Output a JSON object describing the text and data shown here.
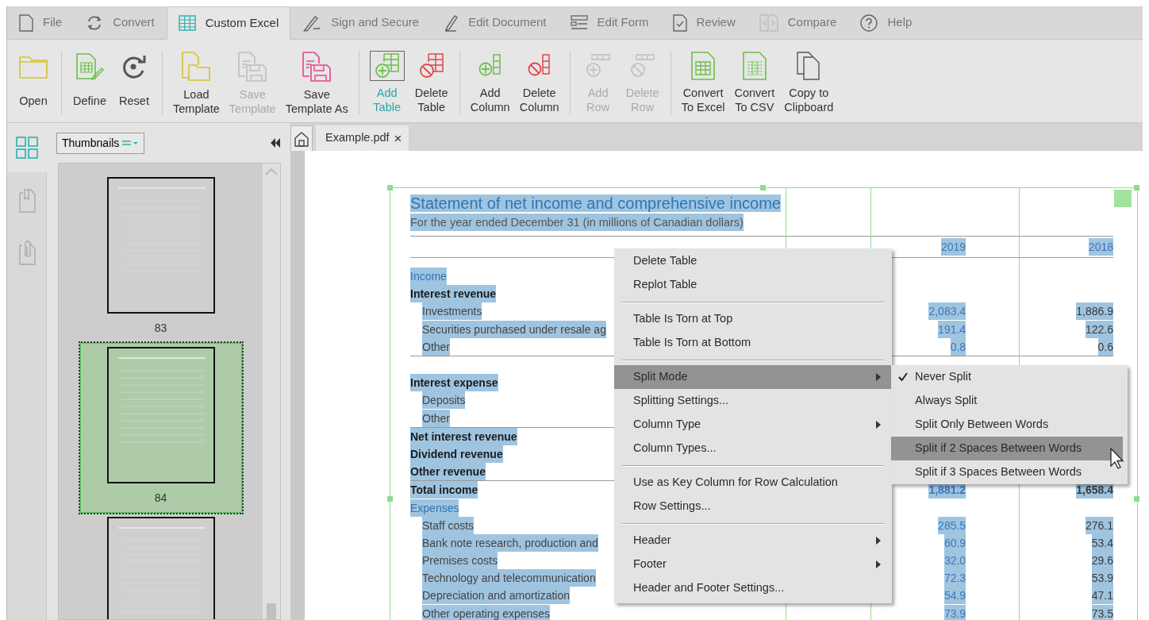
{
  "tabs": [
    {
      "label": "File",
      "selected": false
    },
    {
      "label": "Convert",
      "selected": false
    },
    {
      "label": "Custom Excel",
      "selected": true
    },
    {
      "label": "Sign and Secure",
      "selected": false
    },
    {
      "label": "Edit Document",
      "selected": false
    },
    {
      "label": "Edit Form",
      "selected": false
    },
    {
      "label": "Review",
      "selected": false
    },
    {
      "label": "Compare",
      "selected": false
    },
    {
      "label": "Help",
      "selected": false
    }
  ],
  "ribbon": {
    "groups": [
      [
        {
          "label": "Open",
          "disabled": false,
          "selected": false
        }
      ],
      [
        {
          "label": "Define",
          "disabled": false,
          "selected": false
        },
        {
          "label": "Reset",
          "disabled": false,
          "selected": false
        }
      ],
      [
        {
          "label": "Load\nTemplate",
          "disabled": false,
          "selected": false
        },
        {
          "label": "Save\nTemplate",
          "disabled": true,
          "selected": false
        },
        {
          "label": "Save\nTemplate As",
          "disabled": false,
          "selected": false
        }
      ],
      [
        {
          "label": "Add\nTable",
          "disabled": false,
          "selected": true
        },
        {
          "label": "Delete\nTable",
          "disabled": false,
          "selected": false
        }
      ],
      [
        {
          "label": "Add\nColumn",
          "disabled": false,
          "selected": false
        },
        {
          "label": "Delete\nColumn",
          "disabled": false,
          "selected": false
        }
      ],
      [
        {
          "label": "Add\nRow",
          "disabled": true,
          "selected": false
        },
        {
          "label": "Delete\nRow",
          "disabled": true,
          "selected": false
        }
      ],
      [
        {
          "label": "Convert\nTo Excel",
          "disabled": false,
          "selected": false
        },
        {
          "label": "Convert\nTo CSV",
          "disabled": false,
          "selected": false
        },
        {
          "label": "Copy to\nClipboard",
          "disabled": false,
          "selected": false
        }
      ]
    ]
  },
  "side_panel": {
    "view_select": {
      "value": "Thumbnails"
    },
    "thumbnails": [
      {
        "page": "83",
        "selected": false
      },
      {
        "page": "84",
        "selected": true
      },
      {
        "selected": false
      }
    ]
  },
  "document_tabs": [
    {
      "label": "Example.pdf",
      "close": "×"
    }
  ],
  "document": {
    "title": "Statement of net income and comprehensive income",
    "subtitle": "For the year ended December 31 (in millions of Canadian dollars)",
    "column_headers": [
      "2019",
      "2018"
    ],
    "rows": [
      {
        "kind": "heading",
        "label": "Income"
      },
      {
        "kind": "total",
        "label": "Interest revenue"
      },
      {
        "kind": "item",
        "label": "Investments",
        "values": [
          "2,083.4",
          "1,886.9"
        ]
      },
      {
        "kind": "item",
        "label": "Securities purchased under resale ag",
        "values": [
          "191.4",
          "122.6"
        ]
      },
      {
        "kind": "item",
        "label": "Other",
        "values": [
          "0.8",
          "0.6"
        ]
      },
      {
        "kind": "rule"
      },
      {
        "kind": "spacer"
      },
      {
        "kind": "total",
        "label": "Interest expense"
      },
      {
        "kind": "item",
        "label": "Deposits"
      },
      {
        "kind": "item",
        "label": "Other"
      },
      {
        "kind": "rule"
      },
      {
        "kind": "total",
        "label": "Net interest revenue"
      },
      {
        "kind": "total",
        "label": "Dividend revenue"
      },
      {
        "kind": "total",
        "label": "Other revenue"
      },
      {
        "kind": "rule"
      },
      {
        "kind": "total",
        "label": "Total income",
        "values": [
          "1,881.2",
          "1,658.4"
        ]
      },
      {
        "kind": "heading",
        "label": "Expenses"
      },
      {
        "kind": "item",
        "label": "Staff costs",
        "values": [
          "285.5",
          "276.1"
        ]
      },
      {
        "kind": "item",
        "label": "Bank note research, production and",
        "values": [
          "60.9",
          "53.4"
        ]
      },
      {
        "kind": "item",
        "label": "Premises costs",
        "values": [
          "32.0",
          "29.6"
        ]
      },
      {
        "kind": "item",
        "label": "Technology and telecommunication",
        "values": [
          "72.3",
          "53.9"
        ]
      },
      {
        "kind": "item",
        "label": "Depreciation and amortization",
        "values": [
          "54.9",
          "47.1"
        ]
      },
      {
        "kind": "item",
        "label": "Other operating expenses",
        "values": [
          "73.9",
          "73.5"
        ]
      }
    ]
  },
  "context_menu": {
    "groups": [
      [
        {
          "label": "Delete Table",
          "submenu": false,
          "highlighted": false
        },
        {
          "label": "Replot Table",
          "submenu": false,
          "highlighted": false
        }
      ],
      [
        {
          "label": "Table Is Torn at Top",
          "submenu": false,
          "highlighted": false
        },
        {
          "label": "Table Is Torn at Bottom",
          "submenu": false,
          "highlighted": false
        }
      ],
      [
        {
          "label": "Split Mode",
          "submenu": true,
          "highlighted": true
        },
        {
          "label": "Splitting Settings...",
          "submenu": false,
          "highlighted": false
        },
        {
          "label": "Column Type",
          "submenu": true,
          "highlighted": false
        },
        {
          "label": "Column Types...",
          "submenu": false,
          "highlighted": false
        }
      ],
      [
        {
          "label": "Use as Key Column for Row Calculation",
          "submenu": false,
          "highlighted": false
        },
        {
          "label": "Row Settings...",
          "submenu": false,
          "highlighted": false
        }
      ],
      [
        {
          "label": "Header",
          "submenu": true,
          "highlighted": false
        },
        {
          "label": "Footer",
          "submenu": true,
          "highlighted": false
        },
        {
          "label": "Header and Footer Settings...",
          "submenu": false,
          "highlighted": false
        }
      ]
    ]
  },
  "submenu": {
    "items": [
      {
        "label": "Never Split",
        "checked": true,
        "highlighted": false
      },
      {
        "label": "Always Split",
        "checked": false,
        "highlighted": false
      },
      {
        "label": "Split Only Between Words",
        "checked": false,
        "highlighted": false
      },
      {
        "label": "Split if 2 Spaces Between Words",
        "checked": false,
        "highlighted": true
      },
      {
        "label": "Split if 3 Spaces Between Words",
        "checked": false,
        "highlighted": false
      }
    ]
  }
}
